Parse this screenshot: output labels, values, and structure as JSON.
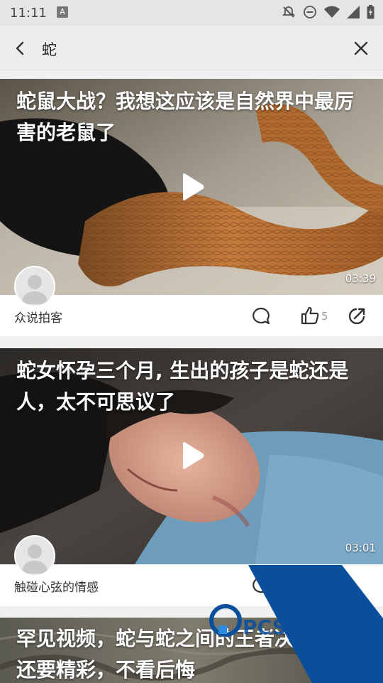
{
  "status_bar": {
    "time": "11:11",
    "app_badge": "A",
    "icons": [
      "notifications-off-icon",
      "do-not-disturb-icon",
      "wifi-icon",
      "signal-icon",
      "battery-icon"
    ]
  },
  "search": {
    "query": "蛇",
    "back_icon": "chevron-left-icon",
    "clear_icon": "close-icon"
  },
  "feed": [
    {
      "title": "蛇鼠大战？我想这应该是自然界中最厉害的老鼠了",
      "duration": "03:39",
      "author": "众说拍客",
      "likes": "5"
    },
    {
      "title": "蛇女怀孕三个月, 生出的孩子是蛇还是人，太不可思议了",
      "duration": "03:01",
      "author": "触碰心弦的情感"
    },
    {
      "title": "罕见视频，蛇与蛇之间的王者决比斗牛还要精彩，不看后悔"
    }
  ],
  "watermark": {
    "text": "PCSOFT下载",
    "color": "#0a4f9c"
  },
  "colors": {
    "status_bg": "#e5e5e5",
    "search_bg": "#ededed",
    "page_bg": "#f0f0f0",
    "title_text": "#ffffff"
  }
}
